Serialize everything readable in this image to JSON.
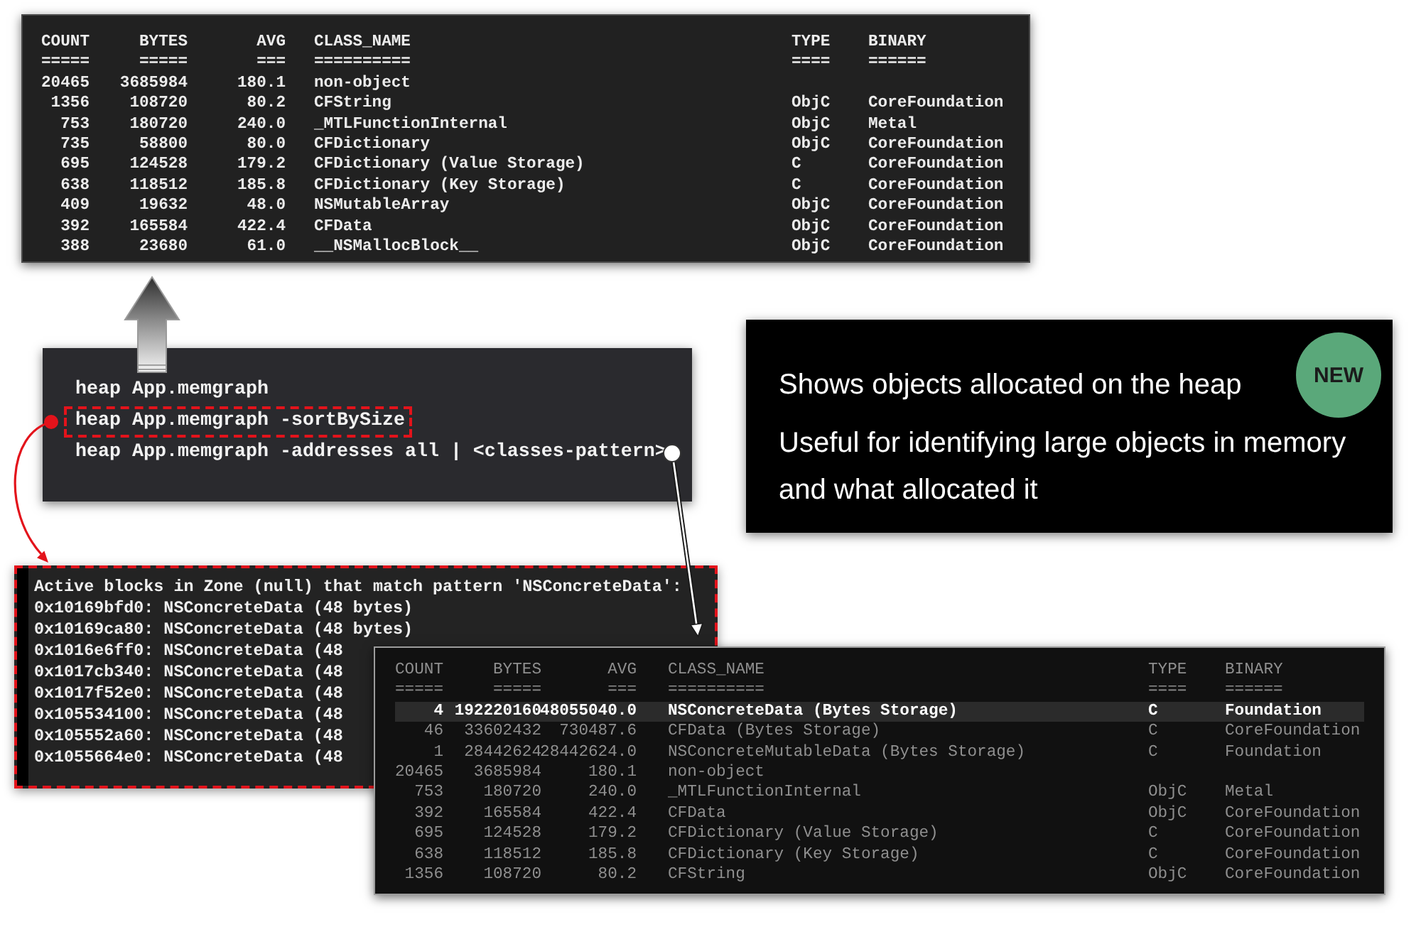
{
  "heap_summary": {
    "columns": [
      "COUNT",
      "BYTES",
      "AVG",
      "CLASS_NAME",
      "TYPE",
      "BINARY"
    ],
    "underlines": [
      "=====",
      "=====",
      "===",
      "==========",
      "====",
      "======"
    ],
    "rows": [
      {
        "count": "20465",
        "bytes": "3685984",
        "avg": "180.1",
        "class_name": "non-object"
      },
      {
        "count": "1356",
        "bytes": "108720",
        "avg": "80.2",
        "class_name": "CFString",
        "type": "ObjC",
        "binary": "CoreFoundation"
      },
      {
        "count": "753",
        "bytes": "180720",
        "avg": "240.0",
        "class_name": "_MTLFunctionInternal",
        "type": "ObjC",
        "binary": "Metal"
      },
      {
        "count": "735",
        "bytes": "58800",
        "avg": "80.0",
        "class_name": "CFDictionary",
        "type": "ObjC",
        "binary": "CoreFoundation"
      },
      {
        "count": "695",
        "bytes": "124528",
        "avg": "179.2",
        "class_name": "CFDictionary (Value Storage)",
        "type": "C",
        "binary": "CoreFoundation"
      },
      {
        "count": "638",
        "bytes": "118512",
        "avg": "185.8",
        "class_name": "CFDictionary (Key Storage)",
        "type": "C",
        "binary": "CoreFoundation"
      },
      {
        "count": "409",
        "bytes": "19632",
        "avg": "48.0",
        "class_name": "NSMutableArray",
        "type": "ObjC",
        "binary": "CoreFoundation"
      },
      {
        "count": "392",
        "bytes": "165584",
        "avg": "422.4",
        "class_name": "CFData",
        "type": "ObjC",
        "binary": "CoreFoundation"
      },
      {
        "count": "388",
        "bytes": "23680",
        "avg": "61.0",
        "class_name": "__NSMallocBlock__",
        "type": "ObjC",
        "binary": "CoreFoundation"
      }
    ]
  },
  "commands": {
    "lines": [
      {
        "text": "heap App.memgraph",
        "highlighted": false
      },
      {
        "text": "heap App.memgraph -sortBySize",
        "highlighted": true
      },
      {
        "text": "heap App.memgraph -addresses all | <classes-pattern>",
        "highlighted": false
      }
    ]
  },
  "info_card": {
    "badge": "NEW",
    "lines": [
      "Shows objects allocated on the heap",
      "Useful for identifying large objects in memory",
      "and what allocated it"
    ]
  },
  "address_output": {
    "lines": [
      "Active blocks in Zone (null) that match pattern 'NSConcreteData':",
      "0x10169bfd0: NSConcreteData (48 bytes)",
      "0x10169ca80: NSConcreteData (48 bytes)",
      "0x1016e6ff0: NSConcreteData (48",
      "0x1017cb340: NSConcreteData (48",
      "0x1017f52e0: NSConcreteData (48",
      "0x105534100: NSConcreteData (48",
      "0x105552a60: NSConcreteData (48",
      "0x1055664e0: NSConcreteData (48"
    ]
  },
  "sorted_heap": {
    "columns": [
      "COUNT",
      "BYTES",
      "AVG",
      "CLASS_NAME",
      "TYPE",
      "BINARY"
    ],
    "underlines": [
      "=====",
      "=====",
      "===",
      "==========",
      "====",
      "======"
    ],
    "rows": [
      {
        "count": "4",
        "bytes": "192220160",
        "avg": "48055040.0",
        "class_name": "NSConcreteData (Bytes Storage)",
        "type": "C",
        "binary": "Foundation",
        "selected": true
      },
      {
        "count": "46",
        "bytes": "33602432",
        "avg": "730487.6",
        "class_name": "CFData (Bytes Storage)",
        "type": "C",
        "binary": "CoreFoundation",
        "selected": false
      },
      {
        "count": "1",
        "bytes": "28442624",
        "avg": "28442624.0",
        "class_name": "NSConcreteMutableData (Bytes Storage)",
        "type": "C",
        "binary": "Foundation",
        "selected": false
      },
      {
        "count": "20465",
        "bytes": "3685984",
        "avg": "180.1",
        "class_name": "non-object",
        "selected": false
      },
      {
        "count": "753",
        "bytes": "180720",
        "avg": "240.0",
        "class_name": "_MTLFunctionInternal",
        "type": "ObjC",
        "binary": "Metal",
        "selected": false
      },
      {
        "count": "392",
        "bytes": "165584",
        "avg": "422.4",
        "class_name": "CFData",
        "type": "ObjC",
        "binary": "CoreFoundation",
        "selected": false
      },
      {
        "count": "695",
        "bytes": "124528",
        "avg": "179.2",
        "class_name": "CFDictionary (Value Storage)",
        "type": "C",
        "binary": "CoreFoundation",
        "selected": false
      },
      {
        "count": "638",
        "bytes": "118512",
        "avg": "185.8",
        "class_name": "CFDictionary (Key Storage)",
        "type": "C",
        "binary": "CoreFoundation",
        "selected": false
      },
      {
        "count": "1356",
        "bytes": "108720",
        "avg": "80.2",
        "class_name": "CFString",
        "type": "ObjC",
        "binary": "CoreFoundation",
        "selected": false
      }
    ]
  }
}
